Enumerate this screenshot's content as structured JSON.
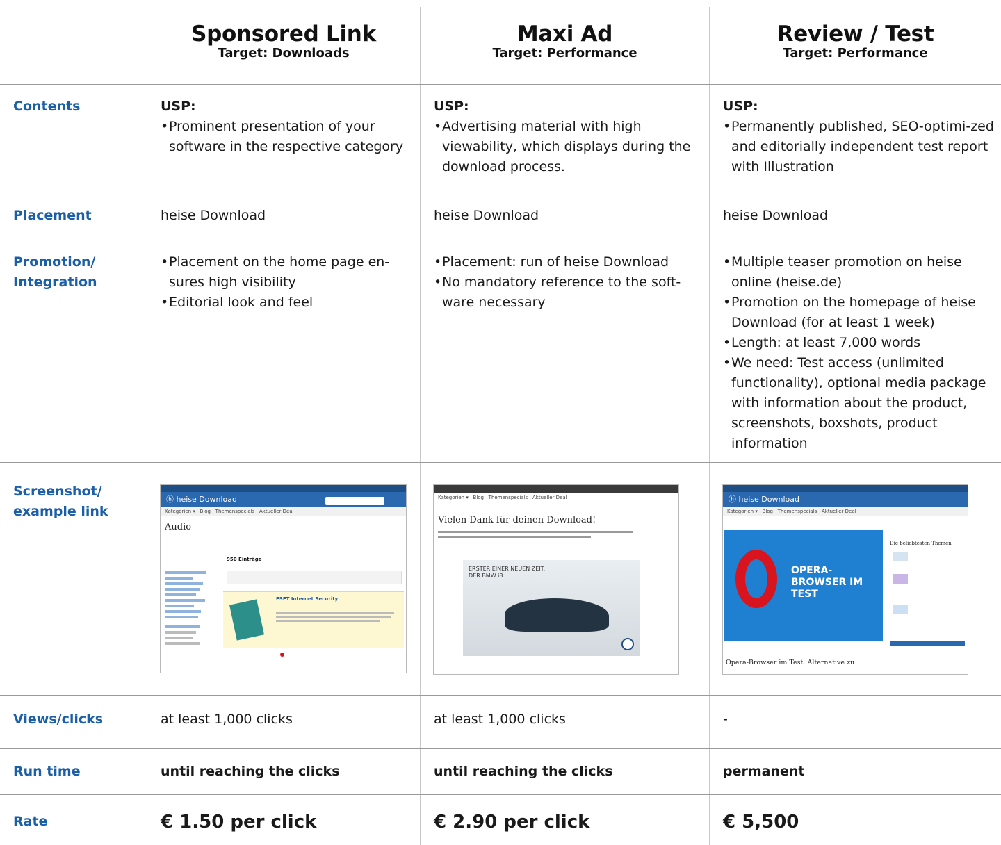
{
  "columns": [
    {
      "title": "Sponsored Link",
      "target": "Target: Downloads"
    },
    {
      "title": "Maxi Ad",
      "target": "Target: Performance"
    },
    {
      "title": "Review / Test",
      "target": "Target: Performance"
    }
  ],
  "rows": {
    "contents": {
      "label": "Contents",
      "usp": "USP:",
      "c1": [
        "Prominent presentation of your software in the respective category"
      ],
      "c2": [
        "Advertising material with high viewability, which displays during the download process."
      ],
      "c3": [
        "Permanently published, SEO-optimi-zed and editorially independent test report with Illustration"
      ]
    },
    "placement": {
      "label": "Placement",
      "c1": "heise Download",
      "c2": "heise Download",
      "c3": "heise Download"
    },
    "promotion": {
      "label": "Promotion/ Integration",
      "c1": [
        "Placement on the home page en-sures high visibility",
        "Editorial look and feel"
      ],
      "c2": [
        "Placement: run of heise Download",
        "No mandatory reference to the soft-ware necessary"
      ],
      "c3": [
        "Multiple teaser promotion on heise online (heise.de)",
        "Promotion on the homepage of heise Download (for at least 1 week)",
        "Length: at least 7,000 words",
        "We need: Test access (unlimited functionality), optional media package with information about the product, screenshots, boxshots, product information"
      ]
    },
    "screenshot": {
      "label": "Screenshot/ example link",
      "s1": {
        "brand": "heise Download",
        "heading": "Audio",
        "count": "950 Einträge",
        "product": "ESET Internet Security"
      },
      "s2": {
        "heading": "Vielen Dank für deinen Download!",
        "ad_text": "ERSTER EINER NEUEN ZEIT. DER BMW i8."
      },
      "s3": {
        "brand": "heise Download",
        "banner": "OPERA-BROWSER IM TEST",
        "side_heading": "Die beliebtesten Themen",
        "article": "Opera-Browser im Test: Alternative zu"
      }
    },
    "views": {
      "label": "Views/clicks",
      "c1": "at least 1,000 clicks",
      "c2": "at least 1,000 clicks",
      "c3": "-"
    },
    "runtime": {
      "label": "Run time",
      "c1": "until reaching the clicks",
      "c2": "until reaching the clicks",
      "c3": "permanent"
    },
    "rate": {
      "label": "Rate",
      "c1": "€ 1.50 per click",
      "c2": "€ 2.90 per click",
      "c3": "€ 5,500"
    }
  },
  "colors": {
    "label": "#1b5fa8",
    "heise_blue": "#2a69b0",
    "opera_red": "#d8141e"
  }
}
